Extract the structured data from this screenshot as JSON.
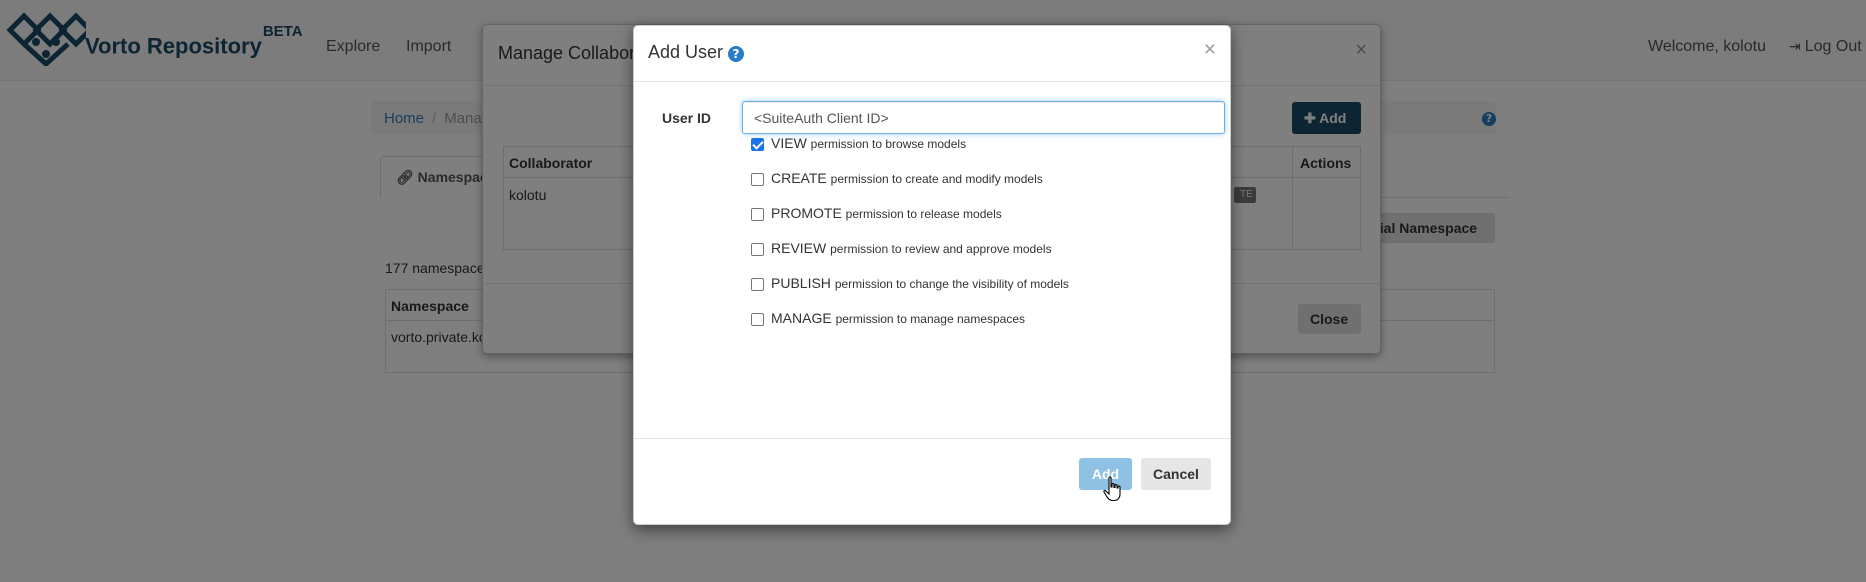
{
  "navbar": {
    "brand": "Vorto Repository",
    "brand_sup": "BETA",
    "links": [
      "Explore",
      "Import"
    ],
    "welcome": "Welcome, kolotu",
    "logout": "Log Out"
  },
  "background": {
    "breadcrumb_home": "Home",
    "breadcrumb_current": "Manag",
    "tab_label": "Namespace",
    "namespace_count": "177 namespace",
    "special_button": "cial Namespace",
    "table_header": "Namespace",
    "table_cell": "vorto.private.ko"
  },
  "manage_modal": {
    "title": "Manage Collabor",
    "close_glyph": "×",
    "add_label": "Add",
    "col_collaborator": "Collaborator",
    "col_actions": "Actions",
    "row_name": "kolotu",
    "badge": "TE",
    "close_label": "Close"
  },
  "add_user_modal": {
    "title": "Add User",
    "close_glyph": "×",
    "field_label": "User ID",
    "user_id_value": "<SuiteAuth Client ID>",
    "permissions": [
      {
        "name": "VIEW",
        "desc": "permission to browse models",
        "checked": true
      },
      {
        "name": "CREATE",
        "desc": "permission to create and modify models",
        "checked": false
      },
      {
        "name": "PROMOTE",
        "desc": "permission to release models",
        "checked": false
      },
      {
        "name": "REVIEW",
        "desc": "permission to review and approve models",
        "checked": false
      },
      {
        "name": "PUBLISH",
        "desc": "permission to change the visibility of models",
        "checked": false
      },
      {
        "name": "MANAGE",
        "desc": "permission to manage namespaces",
        "checked": false
      }
    ],
    "add_label": "Add",
    "cancel_label": "Cancel"
  },
  "colors": {
    "brand": "#1a4a66",
    "add_disabled": "#8ec1e4",
    "help_icon": "#2a7cc7"
  },
  "icons": [
    "vorto-logo-icon",
    "logout-icon",
    "link-icon",
    "help-icon",
    "close-icon",
    "plus-icon",
    "hand-cursor-icon"
  ]
}
